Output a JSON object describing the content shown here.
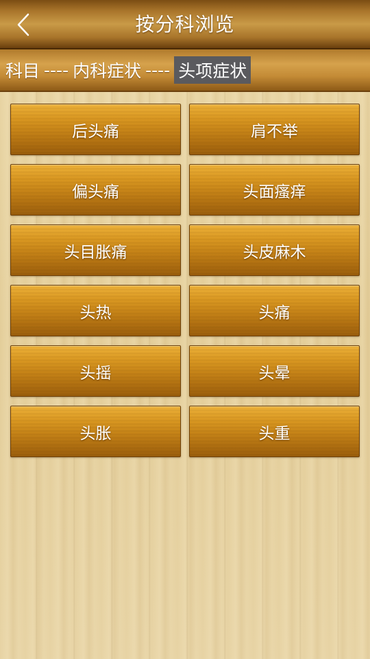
{
  "header": {
    "title": "按分科浏览",
    "back_icon": "chevron-left-icon"
  },
  "breadcrumb": {
    "level1": "科目",
    "sep1": "----",
    "level2": "内科症状",
    "sep2": "----",
    "level3": "头项症状"
  },
  "symptoms": [
    "后头痛",
    "肩不举",
    "偏头痛",
    "头面瘙痒",
    "头目胀痛",
    "头皮麻木",
    "头热",
    "头痛",
    "头摇",
    "头晕",
    "头胀",
    "头重"
  ]
}
